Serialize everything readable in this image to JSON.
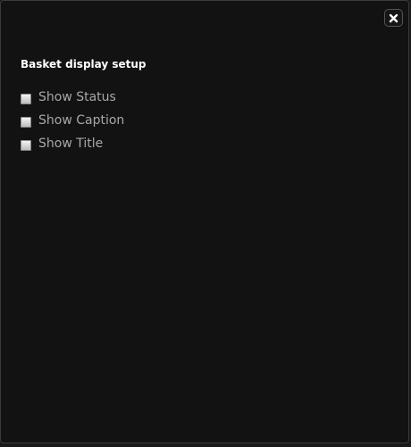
{
  "dialog": {
    "title": "Basket display setup",
    "close_icon": "close-x-icon",
    "options": [
      {
        "label": "Show Status",
        "checked": false
      },
      {
        "label": "Show Caption",
        "checked": false
      },
      {
        "label": "Show Title",
        "checked": false
      }
    ]
  },
  "colors": {
    "background": "#121212",
    "title_text": "#ffffff",
    "option_text": "#a8a8a8"
  }
}
